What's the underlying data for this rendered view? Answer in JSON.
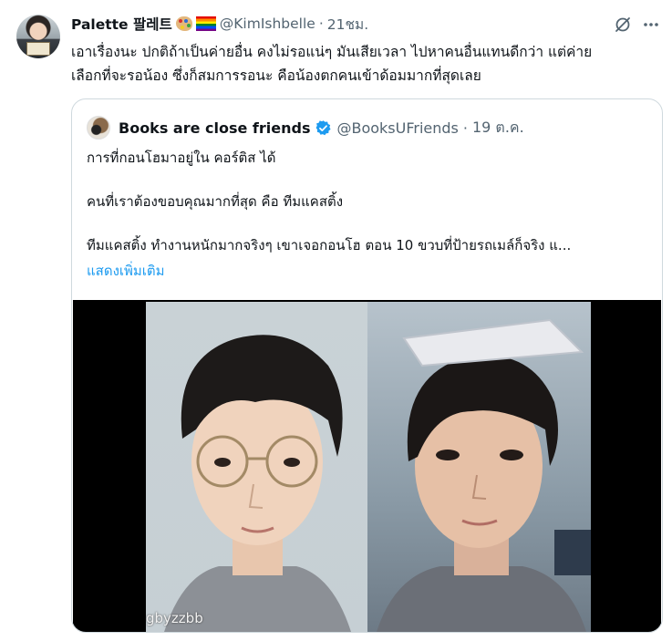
{
  "tweet": {
    "display_name": "Palette 팔레트",
    "handle": "@KimIshbelle",
    "separator": "·",
    "time": "21ชม.",
    "text_line1": "เอาเรื่องนะ ปกติถ้าเป็นค่ายอื่น คงไม่รอแน่ๆ มันเสียเวลา ไปหาคนอื่นแทนดีกว่า แต่ค่าย",
    "text_line2": "เลือกที่จะรอน้อง ซึ่งก็สมการรอนะ คือน้องตกคนเข้าด้อมมากที่สุดเลย"
  },
  "quote": {
    "display_name": "Books are close friends",
    "handle": "@BooksUFriends",
    "separator": "·",
    "time": "19 ต.ค.",
    "line1": "การที่กอนโฮมาอยู่ใน คอร์ติส ได้",
    "line2": "คนที่เราต้องขอบคุณมากที่สุด คือ ทีมแคสติ้ง",
    "line3": "ทีมแคสติ้ง ทำงานหนักมากจริงๆ เขาเจอกอนโฮ ตอน 10 ขวบที่ป้ายรถเมล์ก็จริง แ...",
    "show_more": "แสดงเพิ่มเติม",
    "watermark": "gbyzzbb"
  },
  "colors": {
    "link": "#1d9bf0",
    "secondary_text": "#536471",
    "verified": "#1d9bf0",
    "border": "#cfd9de"
  },
  "icons": {
    "grok": "grok-icon",
    "more": "more-icon",
    "verified": "verified-badge-icon"
  }
}
